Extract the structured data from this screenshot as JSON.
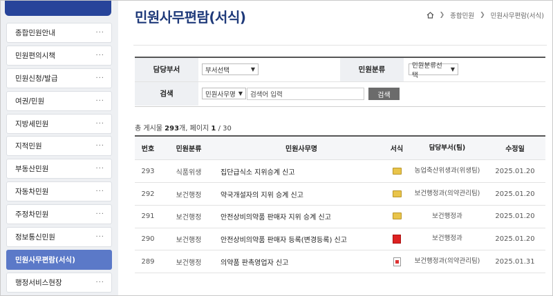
{
  "sidebar": {
    "items": [
      {
        "label": "종합민원안내",
        "active": false
      },
      {
        "label": "민원편의시책",
        "active": false
      },
      {
        "label": "민원신청/발급",
        "active": false
      },
      {
        "label": "여권/민원",
        "active": false
      },
      {
        "label": "지방세민원",
        "active": false
      },
      {
        "label": "지적민원",
        "active": false
      },
      {
        "label": "부동산민원",
        "active": false
      },
      {
        "label": "자동차민원",
        "active": false
      },
      {
        "label": "주정차민원",
        "active": false
      },
      {
        "label": "정보통신민원",
        "active": false
      },
      {
        "label": "민원사무편람(서식)",
        "active": true
      },
      {
        "label": "행정서비스현장",
        "active": false
      }
    ],
    "more": "···"
  },
  "header": {
    "title": "민원사무편람(서식)",
    "breadcrumb": [
      "종합민원",
      "민원사무편람(서식)"
    ]
  },
  "search": {
    "dept_label": "담당부서",
    "dept_value": "부서선택",
    "category_label": "민원분류",
    "category_value": "민원분류선택",
    "search_label": "검색",
    "field_value": "민원사무명",
    "query_placeholder": "검색어 입력",
    "button": "검색"
  },
  "summary": {
    "prefix": "총 게시물",
    "total": "293",
    "unit": "개,",
    "page_label": "페이지",
    "page": "1",
    "pages": "/ 30"
  },
  "table": {
    "headers": [
      "번호",
      "민원분류",
      "민원사무명",
      "서식",
      "담당부서(팀)",
      "수정일"
    ],
    "rows": [
      {
        "no": "293",
        "category": "식품위생",
        "name": "집단급식소 지위승계 신고",
        "form": "folder",
        "dept": "농업축산위생과(위생팀)",
        "date": "2025.01.20"
      },
      {
        "no": "292",
        "category": "보건행정",
        "name": "약국개설자의 지위 승계 신고",
        "form": "folder",
        "dept": "보건행정과(의약관리팀)",
        "date": "2025.01.20"
      },
      {
        "no": "291",
        "category": "보건행정",
        "name": "안전상비의약품 판매자 지위 승계 신고",
        "form": "folder",
        "dept": "보건행정과",
        "date": "2025.01.20"
      },
      {
        "no": "290",
        "category": "보건행정",
        "name": "안전상비의약품 판매자 등록(변경등록) 신고",
        "form": "pdf",
        "dept": "보건행정과",
        "date": "2025.01.20"
      },
      {
        "no": "289",
        "category": "보건행정",
        "name": "의약품 판촉영업자 신고",
        "form": "doc",
        "dept": "보건행정과(의약관리팀)",
        "date": "2025.01.31"
      }
    ]
  }
}
